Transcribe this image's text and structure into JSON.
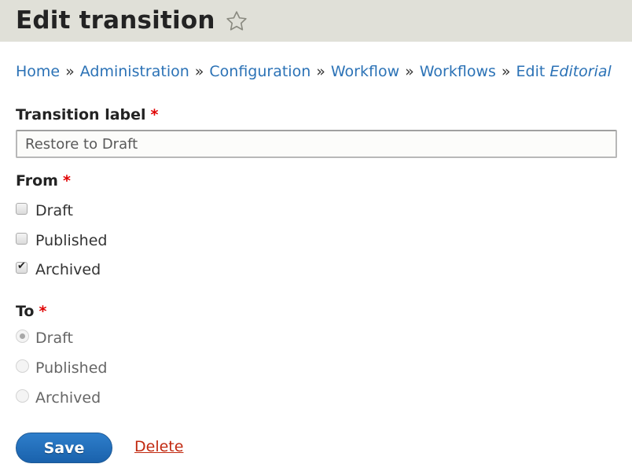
{
  "header": {
    "title": "Edit transition",
    "shortcut_icon": "star-icon"
  },
  "breadcrumb": {
    "separator": "»",
    "items": [
      "Home",
      "Administration",
      "Configuration",
      "Workflow",
      "Workflows"
    ],
    "current_prefix": "Edit ",
    "current_name": "Editorial"
  },
  "form": {
    "transition_label": {
      "label": "Transition label",
      "required_mark": "*",
      "value": "Restore to Draft"
    },
    "from": {
      "label": "From",
      "required_mark": "*",
      "options": [
        {
          "label": "Draft",
          "checked": false
        },
        {
          "label": "Published",
          "checked": false
        },
        {
          "label": "Archived",
          "checked": true
        }
      ]
    },
    "to": {
      "label": "To",
      "required_mark": "*",
      "disabled": true,
      "options": [
        {
          "label": "Draft",
          "selected": true
        },
        {
          "label": "Published",
          "selected": false
        },
        {
          "label": "Archived",
          "selected": false
        }
      ]
    },
    "actions": {
      "save_label": "Save",
      "delete_label": "Delete"
    }
  },
  "colors": {
    "header_bg": "#e0e0d8",
    "link": "#2b72b6",
    "required": "#e00000",
    "primary_button": "#2271c0",
    "danger_link": "#c1280f"
  }
}
